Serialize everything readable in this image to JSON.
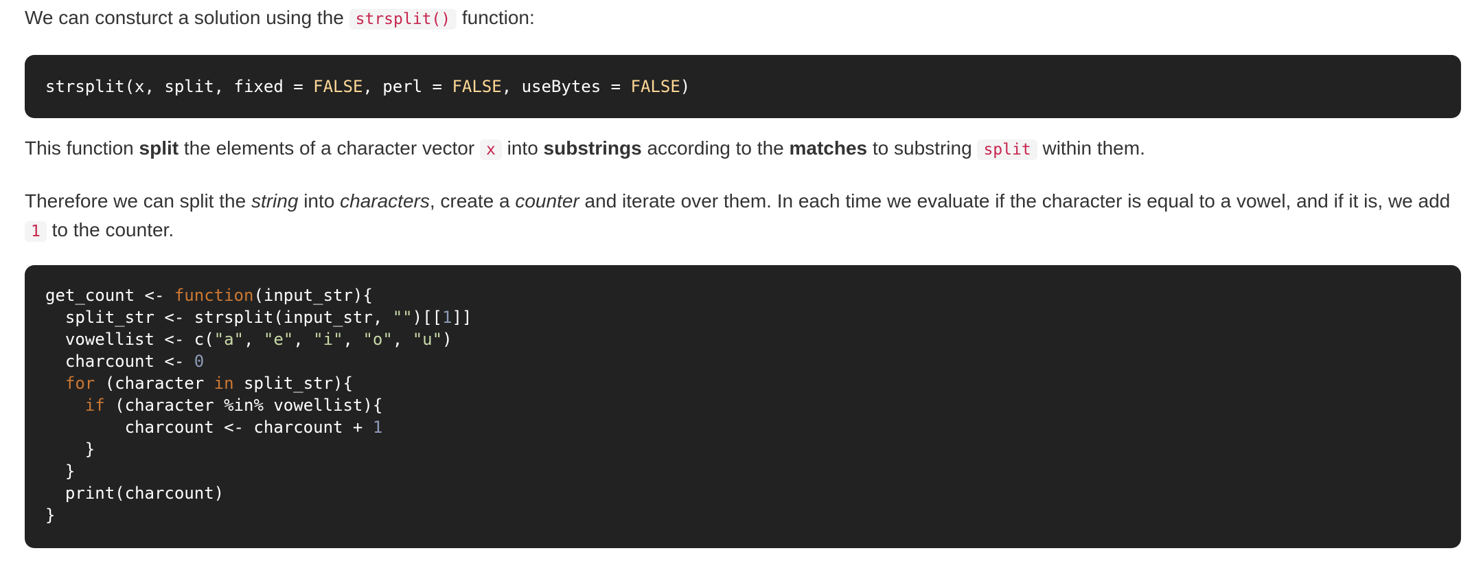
{
  "intro": {
    "before": "We can consturct a solution using the ",
    "code": "strsplit()",
    "after": " function:"
  },
  "code1": {
    "prefix": "strsplit(x, split, fixed = ",
    "const": "FALSE",
    "sep1": ", perl = ",
    "sep2": ", useBytes = ",
    "suffix": ")"
  },
  "para1": {
    "t1": "This function ",
    "b1": "split",
    "t2": " the elements of a character vector ",
    "c1": "x",
    "t3": " into ",
    "b2": "substrings",
    "t4": " according to the ",
    "b3": "matches",
    "t5": " to substring ",
    "c2": "split",
    "t6": " within them."
  },
  "para2": {
    "t1": "Therefore we can split the ",
    "i1": "string",
    "t2": " into ",
    "i2": "characters",
    "t3": ", create a ",
    "i3": "counter",
    "t4": " and iterate over them. In each time we evaluate if the character is equal to a vowel, and if it is, we add ",
    "c1": "1",
    "t5": " to the counter."
  },
  "code2": {
    "l1a": "get_count <- ",
    "l1k": "function",
    "l1b": "(input_str){",
    "l2a": "  split_str <- strsplit(input_str, ",
    "l2s": "\"\"",
    "l2b": ")[[",
    "l2n": "1",
    "l2c": "]]",
    "l3a": "  vowellist <- c(",
    "s_a": "\"a\"",
    "s_e": "\"e\"",
    "s_i": "\"i\"",
    "s_o": "\"o\"",
    "s_u": "\"u\"",
    "comma": ", ",
    "l3b": ")",
    "l4a": "  charcount <- ",
    "l4n": "0",
    "l5a": "  ",
    "l5k": "for",
    "l5b": " (character ",
    "l5k2": "in",
    "l5c": " split_str){",
    "l6a": "    ",
    "l6k": "if",
    "l6b": " (character %in% vowellist){",
    "l7a": "        charcount <- charcount + ",
    "l7n": "1",
    "l8": "    }",
    "l9": "  }",
    "l10": "  print(charcount)",
    "l11": "}"
  }
}
